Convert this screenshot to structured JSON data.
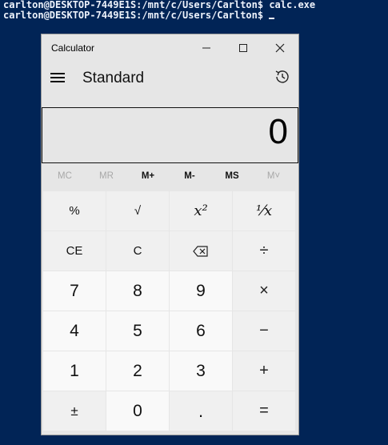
{
  "terminal": {
    "line1": "carlton@DESKTOP-7449E1S:/mnt/c/Users/Carlton$ calc.exe",
    "line2": "carlton@DESKTOP-7449E1S:/mnt/c/Users/Carlton$ "
  },
  "window": {
    "title": "Calculator",
    "mode": "Standard"
  },
  "display": {
    "value": "0"
  },
  "memory": [
    "MC",
    "MR",
    "M+",
    "M-",
    "MS",
    "M˅"
  ],
  "keys": {
    "percent": "%",
    "sqrt": "√",
    "square": "x²",
    "reciprocal": "⅟x",
    "ce": "CE",
    "c": "C",
    "divide": "÷",
    "multiply": "×",
    "minus": "−",
    "plus": "+",
    "equals": "=",
    "negate": "±",
    "decimal": ".",
    "n7": "7",
    "n8": "8",
    "n9": "9",
    "n4": "4",
    "n5": "5",
    "n6": "6",
    "n1": "1",
    "n2": "2",
    "n3": "3",
    "n0": "0"
  }
}
